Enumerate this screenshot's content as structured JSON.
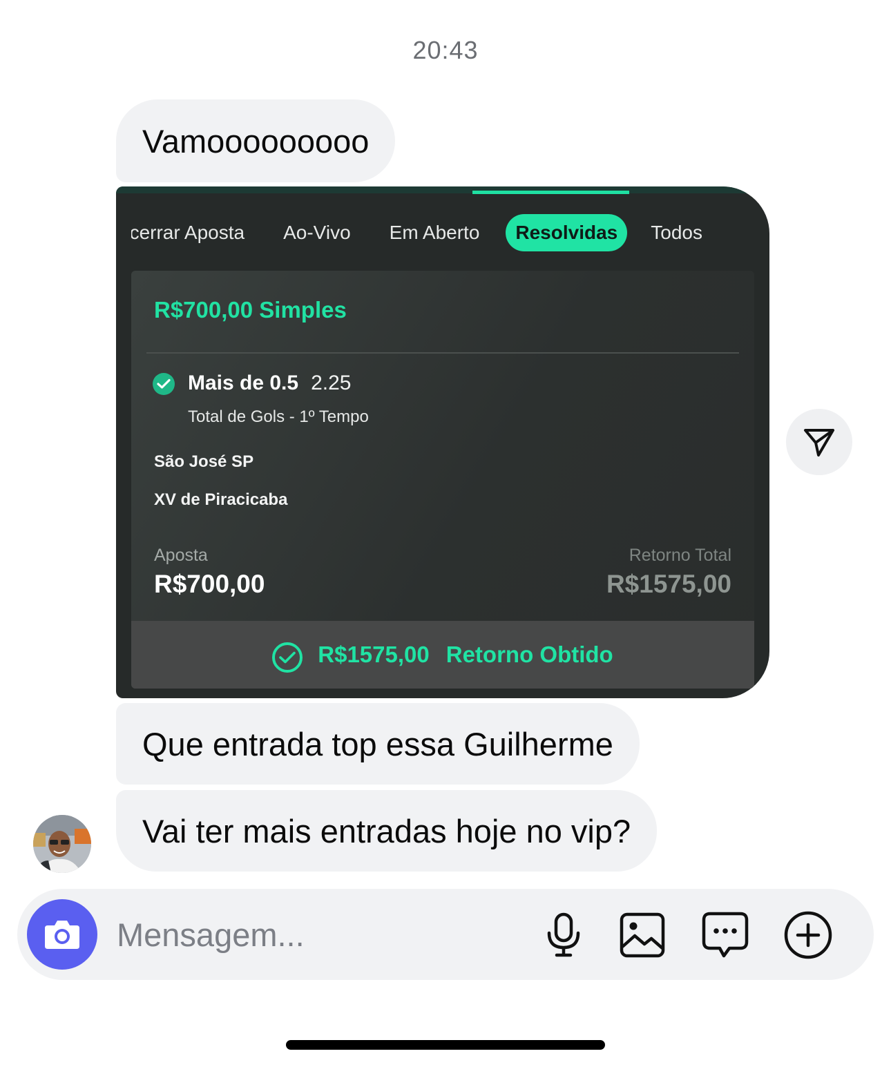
{
  "timestamp": "20:43",
  "messages": [
    {
      "text": "Vamooooooooo"
    },
    {
      "text": "Que entrada top essa Guilherme"
    },
    {
      "text": "Vai ter mais entradas hoje no vip?"
    }
  ],
  "bet_screenshot": {
    "tabs": [
      {
        "label": "ncerrar Aposta",
        "active": false
      },
      {
        "label": "Ao-Vivo",
        "active": false
      },
      {
        "label": "Em Aberto",
        "active": false
      },
      {
        "label": "Resolvidas",
        "active": true
      },
      {
        "label": "Todos",
        "active": false
      }
    ],
    "card": {
      "stake_title": "R$700,00 Simples",
      "selection": "Mais de 0.5",
      "odds": "2.25",
      "market": "Total de Gols - 1º Tempo",
      "team_home": "São José SP",
      "team_away": "XV de Piracicaba",
      "stake_label": "Aposta",
      "stake_value": "R$700,00",
      "return_label": "Retorno Total",
      "return_value": "R$1575,00",
      "result_amount": "R$1575,00",
      "result_label": "Retorno Obtido"
    },
    "accent_color": "#20e3a4"
  },
  "composer": {
    "placeholder": "Mensagem...",
    "icons": [
      "camera-icon",
      "microphone-icon",
      "image-icon",
      "sticker-icon",
      "plus-icon"
    ]
  }
}
